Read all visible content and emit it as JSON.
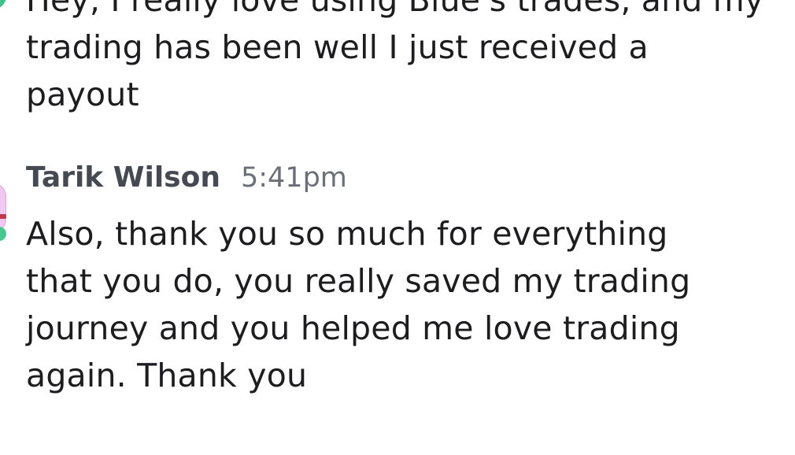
{
  "previous_message": {
    "lines": [
      "Hey, I really love using Blue's trades, and my",
      "trading has been well I just received a",
      "payout"
    ]
  },
  "message": {
    "sender": "Tarik Wilson",
    "time": "5:41pm",
    "lines": [
      "Also, thank you so much for everything",
      "that you do, you really saved my trading",
      "journey and you helped me love trading",
      "again. Thank you"
    ]
  }
}
